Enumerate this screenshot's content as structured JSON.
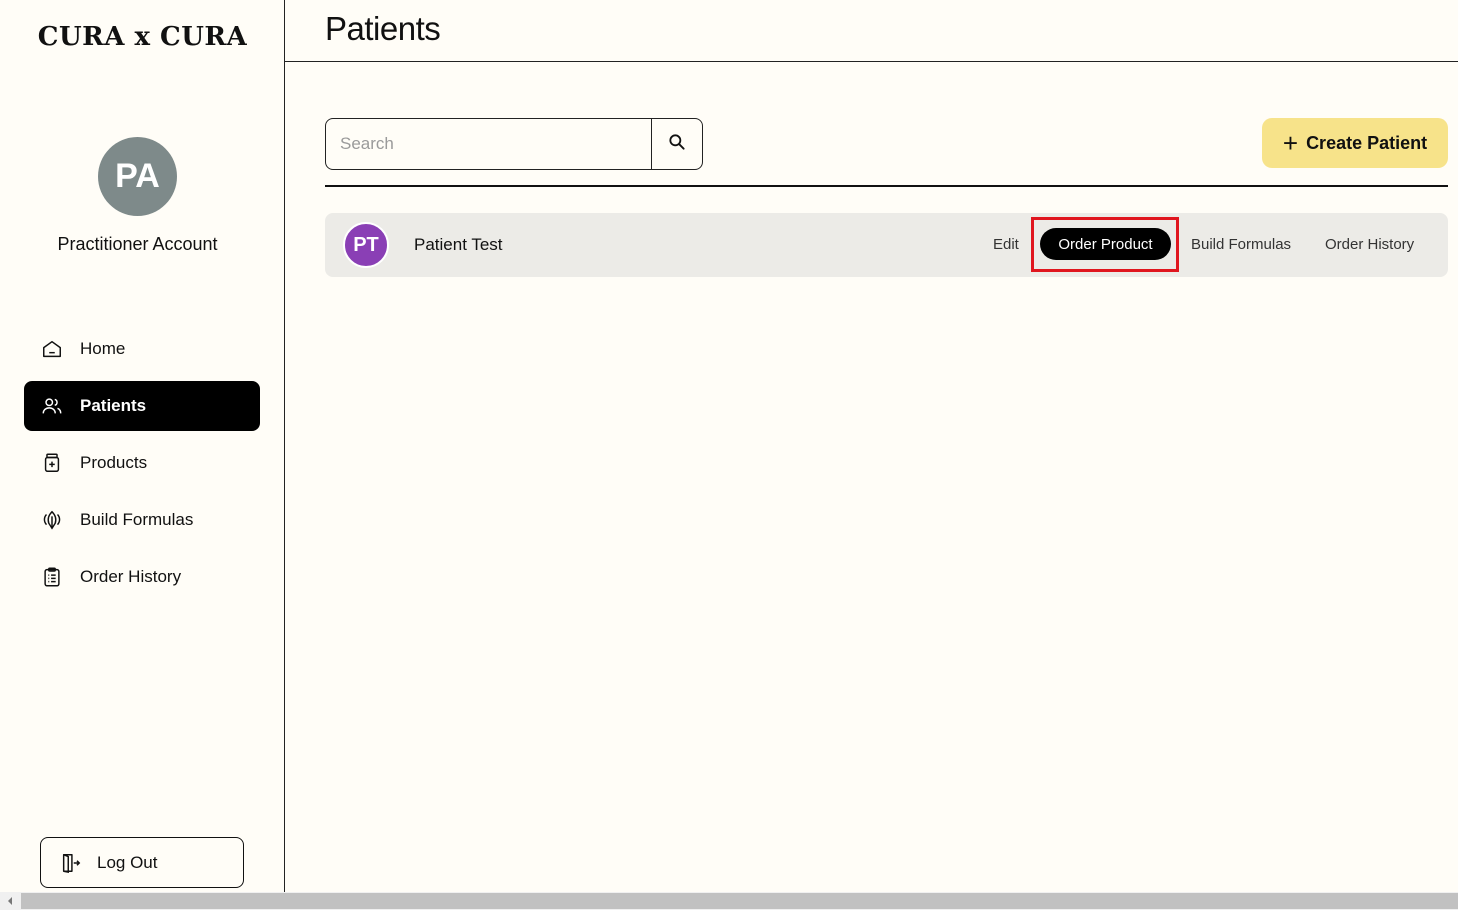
{
  "app": {
    "logo": "CURA x CURA"
  },
  "account": {
    "initials": "PA",
    "name": "Practitioner Account",
    "avatar_color": "#7e8a8a"
  },
  "sidebar": {
    "items": [
      {
        "label": "Home",
        "icon": "home-icon",
        "active": false
      },
      {
        "label": "Patients",
        "icon": "users-icon",
        "active": true
      },
      {
        "label": "Products",
        "icon": "jar-icon",
        "active": false
      },
      {
        "label": "Build Formulas",
        "icon": "leaf-icon",
        "active": false
      },
      {
        "label": "Order History",
        "icon": "clipboard-icon",
        "active": false
      }
    ],
    "logout_label": "Log Out"
  },
  "header": {
    "title": "Patients"
  },
  "toolbar": {
    "search_placeholder": "Search",
    "search_value": "",
    "create_label": "Create Patient",
    "create_color": "#f7e38a"
  },
  "patients": [
    {
      "initials": "PT",
      "name": "Patient Test",
      "avatar_color": "#8a3fb5",
      "actions": {
        "edit": "Edit",
        "order": "Order Product",
        "formulas": "Build Formulas",
        "history": "Order History"
      }
    }
  ],
  "colors": {
    "background": "#fffdf7",
    "active_nav": "#000000",
    "highlight": "#e0161e",
    "row_bg": "#ecebe7"
  }
}
